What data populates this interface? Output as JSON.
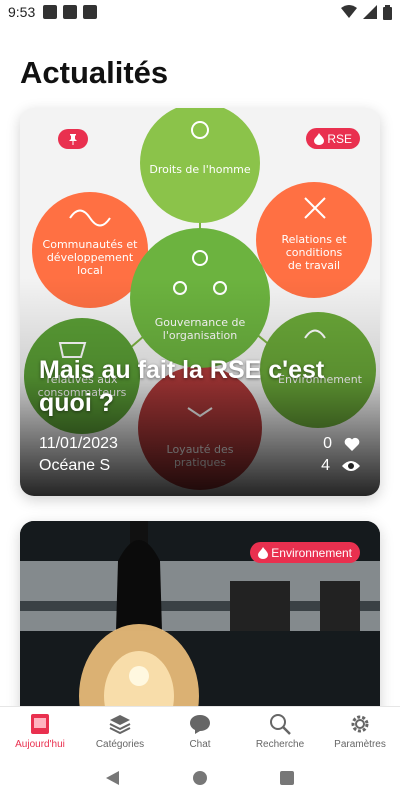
{
  "status_bar": {
    "time": "9:53"
  },
  "page_title": "Actualités",
  "articles": [
    {
      "tag": "RSE",
      "pinned": true,
      "title": "Mais au fait la RSE c'est quoi ?",
      "date": "11/01/2023",
      "author": "Océane S",
      "likes": "0",
      "views": "4",
      "diagram": {
        "center": "Gouvernance de l'organisation",
        "items": [
          "Droits de l'homme",
          "Relations et conditions de travail",
          "Environnement",
          "Loyauté des pratiques",
          "Questions relatives aux consommateurs",
          "Communautés et développement local"
        ]
      }
    },
    {
      "tag": "Environnement"
    }
  ],
  "bottom_nav": [
    {
      "label": "Aujourd'hui",
      "icon": "today-icon",
      "active": true
    },
    {
      "label": "Catégories",
      "icon": "layers-icon"
    },
    {
      "label": "Chat",
      "icon": "chat-icon"
    },
    {
      "label": "Recherche",
      "icon": "search-icon"
    },
    {
      "label": "Paramètres",
      "icon": "gear-icon"
    }
  ],
  "colors": {
    "accent": "#e9304f",
    "green": "#7cb342",
    "orange": "#ff7043"
  }
}
